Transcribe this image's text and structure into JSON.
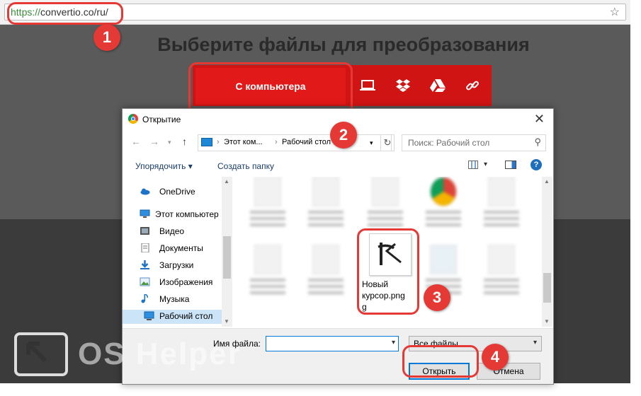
{
  "browser": {
    "url_protocol": "https://",
    "url_rest": "convertio.co/ru/",
    "bookmark_icon": "star-icon"
  },
  "site": {
    "headline": "Выберите файлы для преобразования",
    "from_computer_label": "С компьютера",
    "source_icons": [
      "laptop-icon",
      "dropbox-icon",
      "google-drive-icon",
      "link-icon"
    ],
    "brand_color": "#d01414"
  },
  "dialog": {
    "title": "Открытие",
    "path": [
      "Этот ком...",
      "Рабочий стол"
    ],
    "search_placeholder": "Поиск: Рабочий стол",
    "organize_label": "Упорядочить ▾",
    "new_folder_label": "Создать папку",
    "nav_items": [
      {
        "label": "OneDrive",
        "icon": "onedrive-icon"
      },
      {
        "label": "Этот компьютер",
        "icon": "computer-icon"
      },
      {
        "label": "Видео",
        "icon": "video-icon"
      },
      {
        "label": "Документы",
        "icon": "documents-icon"
      },
      {
        "label": "Загрузки",
        "icon": "downloads-icon"
      },
      {
        "label": "Изображения",
        "icon": "images-icon"
      },
      {
        "label": "Музыка",
        "icon": "music-icon"
      },
      {
        "label": "Рабочий стол",
        "icon": "desktop-icon",
        "selected": true
      }
    ],
    "target_file": {
      "name_line1": "Новый",
      "name_line2": "курсор.png",
      "name_line3": "g"
    },
    "filename_label": "Имя файла:",
    "filename_value": "",
    "filetype_value": "Все файлы",
    "open_label": "Открыть",
    "cancel_label": "Отмена"
  },
  "callouts": [
    "1",
    "2",
    "3",
    "4"
  ],
  "watermark": "OS Helper"
}
